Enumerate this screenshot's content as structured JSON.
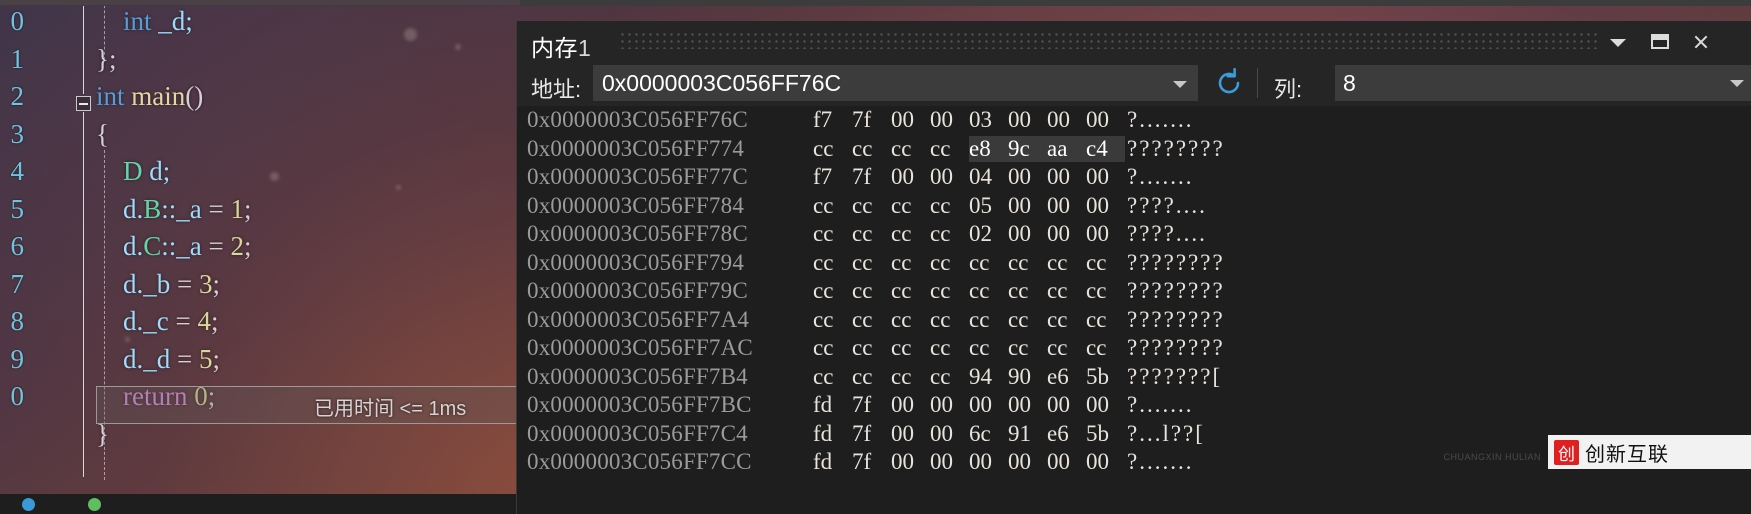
{
  "editor": {
    "line_numbers": [
      "0",
      "1",
      "2",
      "3",
      "4",
      "5",
      "6",
      "7",
      "8",
      "9",
      "0"
    ],
    "lines": [
      {
        "indent": 2,
        "tokens": [
          {
            "t": "int",
            "c": "kw"
          },
          {
            "t": " _d;",
            "c": "var"
          }
        ]
      },
      {
        "indent": 0,
        "tokens": [
          {
            "t": "};",
            "c": "punct"
          }
        ]
      },
      {
        "indent": 0,
        "tokens": [
          {
            "t": "int",
            "c": "kw"
          },
          {
            "t": " ",
            "c": "punct"
          },
          {
            "t": "main",
            "c": "fn"
          },
          {
            "t": "()",
            "c": "punct"
          }
        ]
      },
      {
        "indent": 0,
        "tokens": [
          {
            "t": "{",
            "c": "punct"
          }
        ]
      },
      {
        "indent": 2,
        "tokens": [
          {
            "t": "D",
            "c": "type"
          },
          {
            "t": " d;",
            "c": "var"
          }
        ]
      },
      {
        "indent": 2,
        "tokens": [
          {
            "t": "d.",
            "c": "var"
          },
          {
            "t": "B",
            "c": "type"
          },
          {
            "t": "::_a ",
            "c": "var"
          },
          {
            "t": "= ",
            "c": "punct"
          },
          {
            "t": "1",
            "c": "num"
          },
          {
            "t": ";",
            "c": "punct"
          }
        ]
      },
      {
        "indent": 2,
        "tokens": [
          {
            "t": "d.",
            "c": "var"
          },
          {
            "t": "C",
            "c": "type"
          },
          {
            "t": "::_a ",
            "c": "var"
          },
          {
            "t": "= ",
            "c": "punct"
          },
          {
            "t": "2",
            "c": "num"
          },
          {
            "t": ";",
            "c": "punct"
          }
        ]
      },
      {
        "indent": 2,
        "tokens": [
          {
            "t": "d._b ",
            "c": "var"
          },
          {
            "t": "= ",
            "c": "punct"
          },
          {
            "t": "3",
            "c": "num"
          },
          {
            "t": ";",
            "c": "punct"
          }
        ]
      },
      {
        "indent": 2,
        "tokens": [
          {
            "t": "d._c ",
            "c": "var"
          },
          {
            "t": "= ",
            "c": "punct"
          },
          {
            "t": "4",
            "c": "num"
          },
          {
            "t": ";",
            "c": "punct"
          }
        ]
      },
      {
        "indent": 2,
        "tokens": [
          {
            "t": "d._d ",
            "c": "var"
          },
          {
            "t": "= ",
            "c": "punct"
          },
          {
            "t": "5",
            "c": "num"
          },
          {
            "t": ";",
            "c": "punct"
          }
        ]
      },
      {
        "indent": 2,
        "tokens": [
          {
            "t": "return",
            "c": "ret"
          },
          {
            "t": " ",
            "c": "punct"
          },
          {
            "t": "0",
            "c": "num"
          },
          {
            "t": ";",
            "c": "punct"
          }
        ]
      },
      {
        "indent": 0,
        "tokens": [
          {
            "t": "}",
            "c": "punct"
          }
        ]
      }
    ],
    "elapsed_hint": "已用时间 <= 1ms"
  },
  "memory_window": {
    "title": "内存",
    "index": "1",
    "address_label": "地址:",
    "address_value": "0x0000003C056FF76C",
    "columns_label": "列:",
    "columns_value": "8",
    "refresh_icon": "refresh-icon",
    "chevron_icon": "chevron-down-icon",
    "dock_icon": "dock-window-icon",
    "close_icon": "close-icon",
    "accent_color": "#3b9cd9",
    "rows": [
      {
        "address": "0x0000003C056FF76C",
        "bytes": [
          "f7",
          "7f",
          "00",
          "00",
          "03",
          "00",
          "00",
          "00"
        ],
        "selected": [],
        "ascii": "?......."
      },
      {
        "address": "0x0000003C056FF774",
        "bytes": [
          "cc",
          "cc",
          "cc",
          "cc",
          "e8",
          "9c",
          "aa",
          "c4"
        ],
        "selected": [
          4,
          5,
          6,
          7
        ],
        "ascii": "????????"
      },
      {
        "address": "0x0000003C056FF77C",
        "bytes": [
          "f7",
          "7f",
          "00",
          "00",
          "04",
          "00",
          "00",
          "00"
        ],
        "selected": [],
        "ascii": "?......."
      },
      {
        "address": "0x0000003C056FF784",
        "bytes": [
          "cc",
          "cc",
          "cc",
          "cc",
          "05",
          "00",
          "00",
          "00"
        ],
        "selected": [],
        "ascii": "????...."
      },
      {
        "address": "0x0000003C056FF78C",
        "bytes": [
          "cc",
          "cc",
          "cc",
          "cc",
          "02",
          "00",
          "00",
          "00"
        ],
        "selected": [],
        "ascii": "????...."
      },
      {
        "address": "0x0000003C056FF794",
        "bytes": [
          "cc",
          "cc",
          "cc",
          "cc",
          "cc",
          "cc",
          "cc",
          "cc"
        ],
        "selected": [],
        "ascii": "????????"
      },
      {
        "address": "0x0000003C056FF79C",
        "bytes": [
          "cc",
          "cc",
          "cc",
          "cc",
          "cc",
          "cc",
          "cc",
          "cc"
        ],
        "selected": [],
        "ascii": "????????"
      },
      {
        "address": "0x0000003C056FF7A4",
        "bytes": [
          "cc",
          "cc",
          "cc",
          "cc",
          "cc",
          "cc",
          "cc",
          "cc"
        ],
        "selected": [],
        "ascii": "????????"
      },
      {
        "address": "0x0000003C056FF7AC",
        "bytes": [
          "cc",
          "cc",
          "cc",
          "cc",
          "cc",
          "cc",
          "cc",
          "cc"
        ],
        "selected": [],
        "ascii": "????????"
      },
      {
        "address": "0x0000003C056FF7B4",
        "bytes": [
          "cc",
          "cc",
          "cc",
          "cc",
          "94",
          "90",
          "e6",
          "5b"
        ],
        "selected": [],
        "ascii": "???????["
      },
      {
        "address": "0x0000003C056FF7BC",
        "bytes": [
          "fd",
          "7f",
          "00",
          "00",
          "00",
          "00",
          "00",
          "00"
        ],
        "selected": [],
        "ascii": "?......."
      },
      {
        "address": "0x0000003C056FF7C4",
        "bytes": [
          "fd",
          "7f",
          "00",
          "00",
          "6c",
          "91",
          "e6",
          "5b"
        ],
        "selected": [],
        "ascii": "?...l??["
      },
      {
        "address": "0x0000003C056FF7CC",
        "bytes": [
          "fd",
          "7f",
          "00",
          "00",
          "00",
          "00",
          "00",
          "00"
        ],
        "selected": [],
        "ascii": "?......."
      }
    ]
  },
  "watermark": {
    "mark": "创",
    "text": "创新互联",
    "sub": "CHUANGXIN HULIAN"
  }
}
